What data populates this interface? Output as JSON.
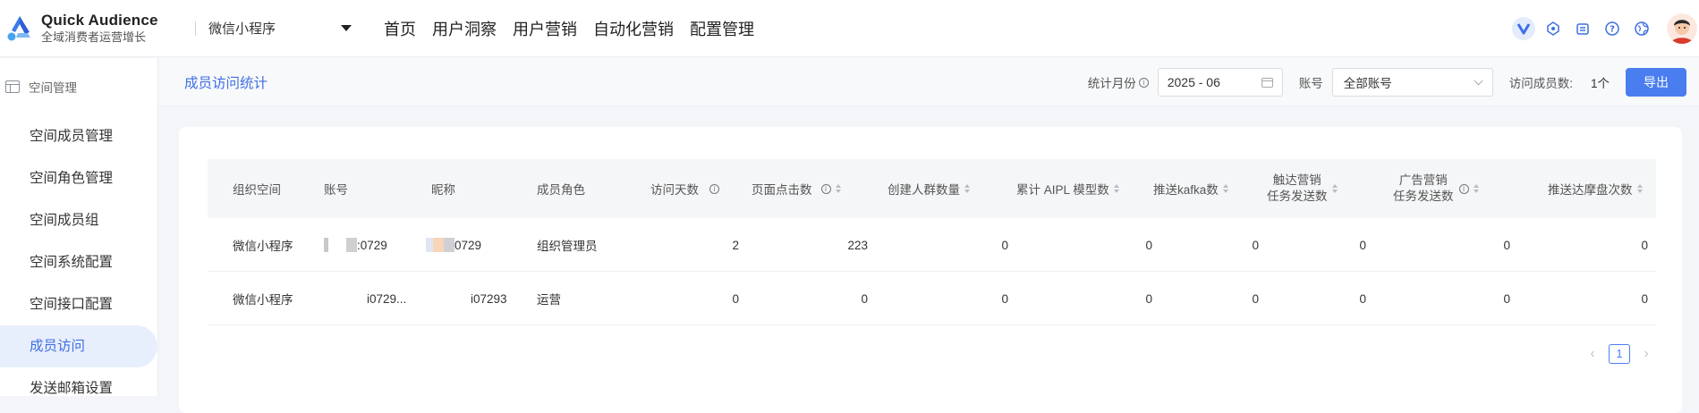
{
  "app": {
    "title": "Quick Audience",
    "subtitle": "全域消费者运营增长"
  },
  "workspace": {
    "selected": "微信小程序"
  },
  "nav": [
    {
      "label": "首页"
    },
    {
      "label": "用户洞察"
    },
    {
      "label": "用户营销"
    },
    {
      "label": "自动化营销"
    },
    {
      "label": "配置管理"
    }
  ],
  "sidebar": {
    "group": "空间管理",
    "items": [
      {
        "label": "空间成员管理"
      },
      {
        "label": "空间角色管理"
      },
      {
        "label": "空间成员组"
      },
      {
        "label": "空间系统配置"
      },
      {
        "label": "空间接口配置"
      },
      {
        "label": "成员访问"
      },
      {
        "label": "发送邮箱设置"
      }
    ],
    "active_index": 5
  },
  "subheader": {
    "title": "成员访问统计",
    "month_label": "统计月份",
    "month_value": "2025 - 06",
    "account_label": "账号",
    "account_value": "全部账号",
    "count_label": "访问成员数:",
    "count_value": "1个",
    "export_label": "导出"
  },
  "table": {
    "headers": {
      "org": "组织空间",
      "account": "账号",
      "nickname": "昵称",
      "role": "成员角色",
      "visit_days": "访问天数",
      "page_clicks": "页面点击数",
      "audience": "创建人群数量",
      "aipl": "累计 AIPL 模型数",
      "kafka": "推送kafka数",
      "touch_l1": "触达营销",
      "touch_l2": "任务发送数",
      "ad_l1": "广告营销",
      "ad_l2": "任务发送数",
      "push_mp": "推送达摩盘次数"
    },
    "rows": [
      {
        "org": "微信小程序",
        "account": ":0729",
        "nickname": "0729",
        "role": "组织管理员",
        "visit_days": "2",
        "page_clicks": "223",
        "audience": "0",
        "aipl": "0",
        "kafka": "0",
        "touch": "0",
        "ad": "0",
        "push_mp": "0"
      },
      {
        "org": "微信小程序",
        "account": "i0729...",
        "nickname": "i07293",
        "role": "运营",
        "visit_days": "0",
        "page_clicks": "0",
        "audience": "0",
        "aipl": "0",
        "kafka": "0",
        "touch": "0",
        "ad": "0",
        "push_mp": "0"
      }
    ]
  },
  "pagination": {
    "current": "1"
  },
  "colors": {
    "accent": "#4a7ef0",
    "active_bg": "#e8effc"
  }
}
